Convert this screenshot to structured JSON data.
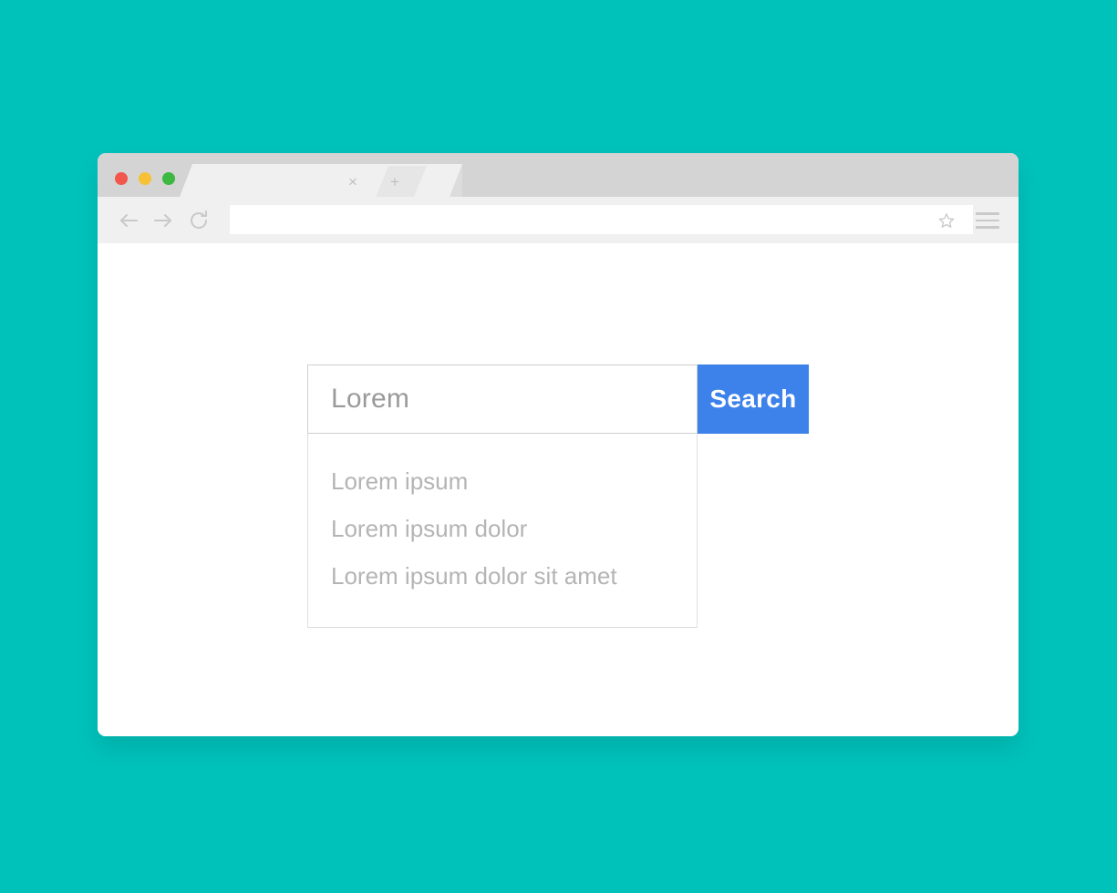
{
  "background": {
    "color": "#00c2bb"
  },
  "browser": {
    "title_bar": {
      "traffic_lights": [
        {
          "name": "close",
          "color": "#f2564c"
        },
        {
          "name": "minimize",
          "color": "#f7c137"
        },
        {
          "name": "maximize",
          "color": "#3db840"
        }
      ],
      "tabs": [
        {
          "label": "",
          "close_icon": "×"
        }
      ],
      "new_tab_icon": "+"
    },
    "toolbar": {
      "back_icon": "back-arrow-icon",
      "forward_icon": "forward-arrow-icon",
      "reload_icon": "reload-icon",
      "url_value": "",
      "url_placeholder": "",
      "bookmark_icon": "star-icon",
      "menu_icon": "hamburger-menu-icon"
    }
  },
  "page": {
    "search": {
      "input_value": "Lorem",
      "input_placeholder": "Lorem",
      "button_label": "Search",
      "button_color": "#3d82ea",
      "suggestions": [
        "Lorem ipsum",
        "Lorem ipsum dolor",
        "Lorem ipsum dolor sit amet"
      ]
    }
  }
}
